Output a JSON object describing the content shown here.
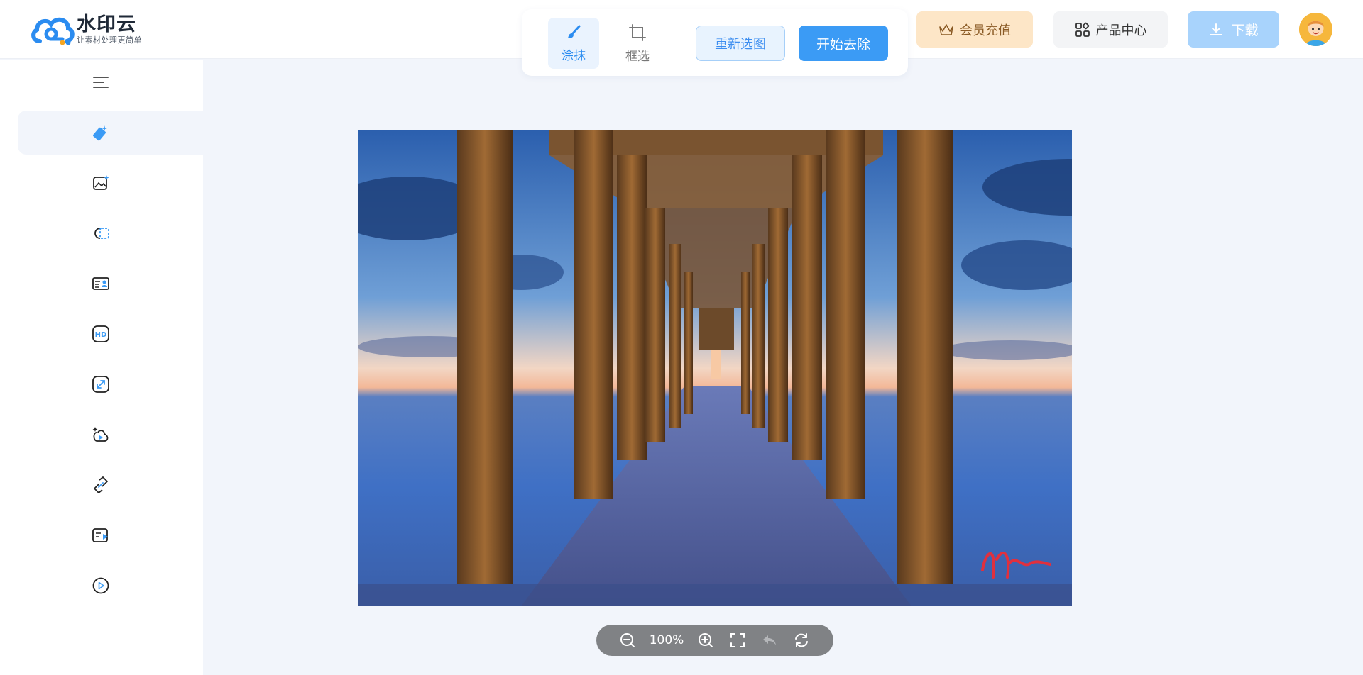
{
  "header": {
    "logo": {
      "name": "水印云",
      "slogan": "让素材处理更简单"
    },
    "member_label": "会员充值",
    "product_label": "产品中心",
    "download_label": "下载"
  },
  "toolbar": {
    "tools": [
      {
        "label": "涂抹",
        "icon": "brush-icon",
        "active": true
      },
      {
        "label": "框选",
        "icon": "crop-icon",
        "active": false
      }
    ],
    "reselect_label": "重新选图",
    "start_label": "开始去除"
  },
  "sidebar": {
    "items": [
      {
        "icon": "collapse-menu-icon"
      },
      {
        "icon": "eraser-icon",
        "active": true
      },
      {
        "icon": "image-enhance-icon"
      },
      {
        "icon": "cutout-icon"
      },
      {
        "icon": "id-photo-icon"
      },
      {
        "icon": "hd-icon"
      },
      {
        "icon": "expand-image-icon"
      },
      {
        "icon": "ai-video-icon"
      },
      {
        "icon": "link-icon"
      },
      {
        "icon": "video-text-icon"
      },
      {
        "icon": "play-icon"
      }
    ]
  },
  "zoom": {
    "value": "100%"
  },
  "colors": {
    "accent": "#3b9bf5",
    "member_bg": "#fde6c7",
    "sidebar_active": "#f2f5fb"
  }
}
